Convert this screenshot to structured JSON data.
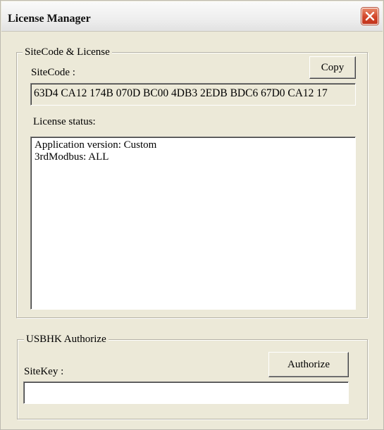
{
  "window": {
    "title": "License Manager"
  },
  "sitecode_license": {
    "group_title": "SiteCode & License",
    "sitecode_label": "SiteCode :",
    "copy_button": "Copy",
    "sitecode_value": "63D4 CA12 174B 070D BC00 4DB3 2EDB BDC6 67D0 CA12 17",
    "license_status_label": "License status:",
    "license_status_lines": [
      "Application version:  Custom",
      "3rdModbus: ALL"
    ]
  },
  "usbhk_authorize": {
    "group_title": "USBHK Authorize",
    "sitekey_label": "SiteKey :",
    "authorize_button": "Authorize",
    "sitekey_value": ""
  },
  "icons": {
    "close": "close-icon"
  }
}
